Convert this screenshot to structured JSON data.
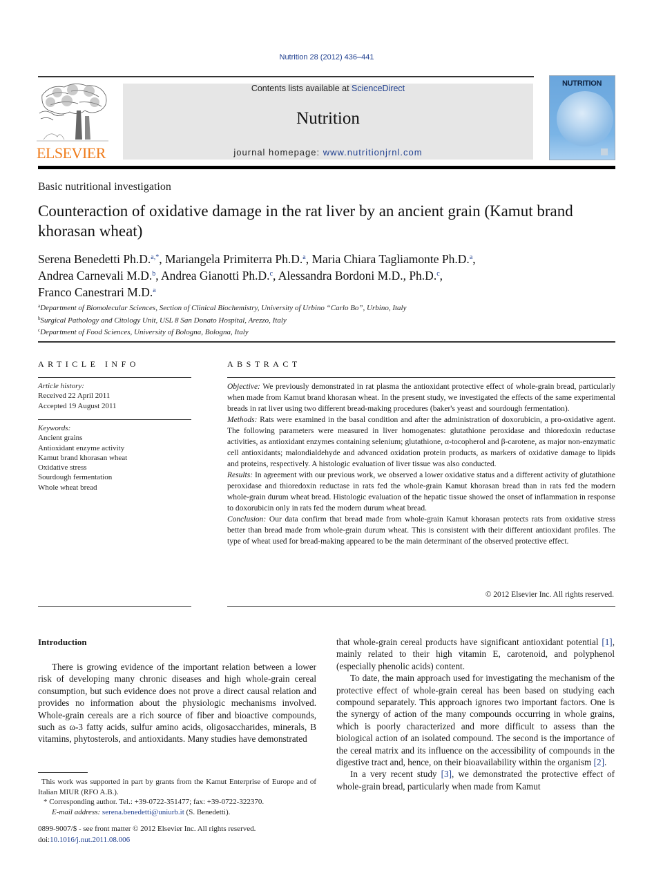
{
  "header": {
    "citation": "Nutrition 28 (2012) 436–441",
    "publisher_logo_text": "ELSEVIER",
    "contents_prefix": "Contents lists available at ",
    "contents_link": "ScienceDirect",
    "journal_name": "Nutrition",
    "homepage_prefix": "journal homepage: ",
    "homepage_link": "www.nutritionjrnl.com",
    "cover_title": "NUTRITION"
  },
  "article": {
    "section": "Basic nutritional investigation",
    "title": "Counteraction of oxidative damage in the rat liver by an ancient grain (Kamut brand khorasan wheat)",
    "authors": [
      {
        "name": "Serena Benedetti Ph.D.",
        "aff": "a,*",
        "sep": ", "
      },
      {
        "name": "Mariangela Primiterra Ph.D.",
        "aff": "a",
        "sep": ", "
      },
      {
        "name": "Maria Chiara Tagliamonte Ph.D.",
        "aff": "a",
        "sep": ","
      },
      {
        "name": "Andrea Carnevali M.D.",
        "aff": "b",
        "sep": ", "
      },
      {
        "name": "Andrea Gianotti Ph.D.",
        "aff": "c",
        "sep": ", "
      },
      {
        "name": "Alessandra Bordoni M.D., Ph.D.",
        "aff": "c",
        "sep": ","
      },
      {
        "name": "Franco Canestrari M.D.",
        "aff": "a",
        "sep": ""
      }
    ],
    "affiliations": [
      {
        "key": "a",
        "text": "Department of Biomolecular Sciences, Section of Clinical Biochemistry, University of Urbino “Carlo Bo”, Urbino, Italy"
      },
      {
        "key": "b",
        "text": "Surgical Pathology and Citology Unit, USL 8 San Donato Hospital, Arezzo, Italy"
      },
      {
        "key": "c",
        "text": "Department of Food Sciences, University of Bologna, Bologna, Italy"
      }
    ]
  },
  "article_info": {
    "heading": "ARTICLE INFO",
    "history_label": "Article history:",
    "received": "Received 22 April 2011",
    "accepted": "Accepted 19 August 2011",
    "keywords_label": "Keywords:",
    "keywords": [
      "Ancient grains",
      "Antioxidant enzyme activity",
      "Kamut brand khorasan wheat",
      "Oxidative stress",
      "Sourdough fermentation",
      "Whole wheat bread"
    ]
  },
  "abstract": {
    "heading": "ABSTRACT",
    "sections": [
      {
        "label": "Objective:",
        "text": " We previously demonstrated in rat plasma the antioxidant protective effect of whole-grain bread, particularly when made from Kamut brand khorasan wheat. In the present study, we investigated the effects of the same experimental breads in rat liver using two different bread-making procedures (baker's yeast and sourdough fermentation)."
      },
      {
        "label": "Methods:",
        "text": " Rats were examined in the basal condition and after the administration of doxorubicin, a pro-oxidative agent. The following parameters were measured in liver homogenates: glutathione peroxidase and thioredoxin reductase activities, as antioxidant enzymes containing selenium; glutathione, α-tocopherol and β-carotene, as major non-enzymatic cell antioxidants; malondialdehyde and advanced oxidation protein products, as markers of oxidative damage to lipids and proteins, respectively. A histologic evaluation of liver tissue was also conducted."
      },
      {
        "label": "Results:",
        "text": " In agreement with our previous work, we observed a lower oxidative status and a different activity of glutathione peroxidase and thioredoxin reductase in rats fed the whole-grain Kamut khorasan bread than in rats fed the modern whole-grain durum wheat bread. Histologic evaluation of the hepatic tissue showed the onset of inflammation in response to doxorubicin only in rats fed the modern durum wheat bread."
      },
      {
        "label": "Conclusion:",
        "text": " Our data confirm that bread made from whole-grain Kamut khorasan protects rats from oxidative stress better than bread made from whole-grain durum wheat. This is consistent with their different antioxidant profiles. The type of wheat used for bread-making appeared to be the main determinant of the observed protective effect."
      }
    ],
    "copyright": "© 2012 Elsevier Inc. All rights reserved."
  },
  "introduction": {
    "heading": "Introduction",
    "left_paragraph": "There is growing evidence of the important relation between a lower risk of developing many chronic diseases and high whole-grain cereal consumption, but such evidence does not prove a direct causal relation and provides no information about the physiologic mechanisms involved. Whole-grain cereals are a rich source of fiber and bioactive compounds, such as ω-3 fatty acids, sulfur amino acids, oligosaccharides, minerals, B vitamins, phytosterols, and antioxidants. Many studies have demonstrated",
    "right_p1_a": "that whole-grain cereal products have significant antioxidant potential ",
    "ref1": "[1]",
    "right_p1_b": ", mainly related to their high vitamin E, carotenoid, and polyphenol (especially phenolic acids) content.",
    "right_p2_a": "To date, the main approach used for investigating the mechanism of the protective effect of whole-grain cereal has been based on studying each compound separately. This approach ignores two important factors. One is the synergy of action of the many compounds occurring in whole grains, which is poorly characterized and more difficult to assess than the biological action of an isolated compound. The second is the importance of the cereal matrix and its influence on the accessibility of compounds in the digestive tract and, hence, on their bioavailability within the organism ",
    "ref2": "[2]",
    "right_p2_b": ".",
    "right_p3_a": "In a very recent study ",
    "ref3": "[3]",
    "right_p3_b": ", we demonstrated the protective effect of whole-grain bread, particularly when made from Kamut"
  },
  "footnotes": {
    "funding": "This work was supported in part by grants from the Kamut Enterprise of Europe and of Italian MIUR (RFO A.B.).",
    "corresponding": "* Corresponding author. Tel.: +39-0722-351477; fax: +39-0722-322370.",
    "email_label": "E-mail address:",
    "email": "serena.benedetti@uniurb.it",
    "email_suffix": " (S. Benedetti).",
    "issn": "0899-9007/$ - see front matter © 2012 Elsevier Inc. All rights reserved.",
    "doi_label": "doi:",
    "doi": "10.1016/j.nut.2011.08.006"
  }
}
